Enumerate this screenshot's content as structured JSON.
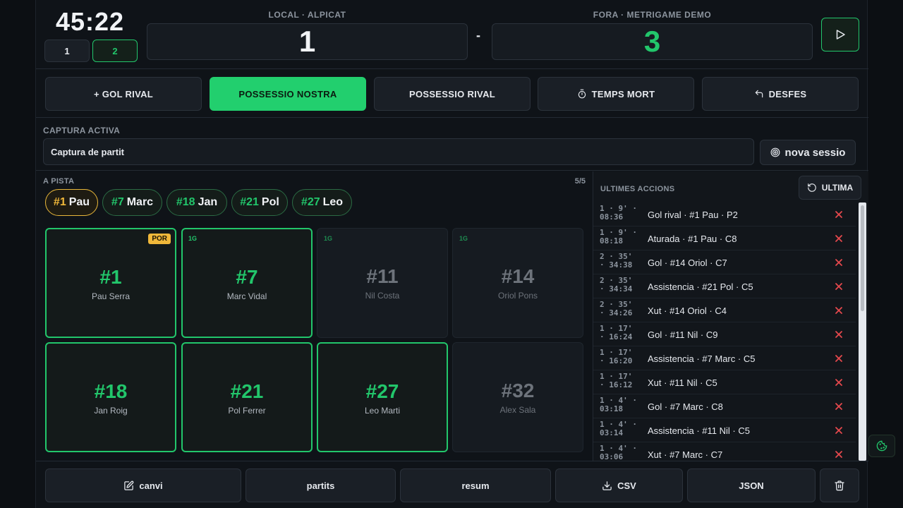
{
  "header": {
    "clock": "45:22",
    "halves": [
      "1",
      "2"
    ],
    "active_half": "2",
    "home_label": "LOCAL · ALPICAT",
    "away_label": "FORA · METRIGAME DEMO",
    "home_score": "1",
    "away_score": "3",
    "separator": "-"
  },
  "actions": {
    "gol_rival": "+ GOL RIVAL",
    "possessio_nostra": "POSSESSIO NOSTRA",
    "possessio_rival": "POSSESSIO RIVAL",
    "temps_mort": "TEMPS MORT",
    "desfes": "DESFES"
  },
  "capture": {
    "label": "CAPTURA ACTIVA",
    "value": "Captura de partit",
    "new_session": "nova sessio"
  },
  "pitch": {
    "label": "A PISTA",
    "count": "5/5",
    "chips": [
      {
        "num": "#1",
        "name": "Pau",
        "gk": true
      },
      {
        "num": "#7",
        "name": "Marc",
        "gk": false
      },
      {
        "num": "#18",
        "name": "Jan",
        "gk": false
      },
      {
        "num": "#21",
        "name": "Pol",
        "gk": false
      },
      {
        "num": "#27",
        "name": "Leo",
        "gk": false
      }
    ],
    "players": [
      {
        "num": "#1",
        "name": "Pau Serra",
        "on": true,
        "goals": "",
        "role": "POR"
      },
      {
        "num": "#7",
        "name": "Marc Vidal",
        "on": true,
        "goals": "1G",
        "role": ""
      },
      {
        "num": "#11",
        "name": "Nil Costa",
        "on": false,
        "goals": "1G",
        "role": ""
      },
      {
        "num": "#14",
        "name": "Oriol Pons",
        "on": false,
        "goals": "1G",
        "role": ""
      },
      {
        "num": "#18",
        "name": "Jan Roig",
        "on": true,
        "goals": "",
        "role": ""
      },
      {
        "num": "#21",
        "name": "Pol Ferrer",
        "on": true,
        "goals": "",
        "role": ""
      },
      {
        "num": "#27",
        "name": "Leo Marti",
        "on": true,
        "goals": "",
        "role": ""
      },
      {
        "num": "#32",
        "name": "Alex Sala",
        "on": false,
        "goals": "",
        "role": ""
      }
    ]
  },
  "log": {
    "title": "ULTIMES ACCIONS",
    "last_button": "ULTIMA",
    "entries": [
      {
        "time": "1 · 9' ·\n08:36",
        "desc": "Gol rival · #1 Pau · P2"
      },
      {
        "time": "1 · 9' ·\n08:18",
        "desc": "Aturada · #1 Pau · C8"
      },
      {
        "time": "2 · 35'\n· 34:38",
        "desc": "Gol · #14 Oriol · C7"
      },
      {
        "time": "2 · 35'\n· 34:34",
        "desc": "Assistencia · #21 Pol · C5"
      },
      {
        "time": "2 · 35'\n· 34:26",
        "desc": "Xut · #14 Oriol · C4"
      },
      {
        "time": "1 · 17'\n· 16:24",
        "desc": "Gol · #11 Nil · C9"
      },
      {
        "time": "1 · 17'\n· 16:20",
        "desc": "Assistencia · #7 Marc · C5"
      },
      {
        "time": "1 · 17'\n· 16:12",
        "desc": "Xut · #11 Nil · C5"
      },
      {
        "time": "1 · 4' ·\n03:18",
        "desc": "Gol · #7 Marc · C8"
      },
      {
        "time": "1 · 4' ·\n03:14",
        "desc": "Assistencia · #11 Nil · C5"
      },
      {
        "time": "1 · 4' ·\n03:06",
        "desc": "Xut · #7 Marc · C7"
      }
    ]
  },
  "footer": {
    "canvi": "canvi",
    "partits": "partits",
    "resum": "resum",
    "csv": "CSV",
    "json": "JSON"
  },
  "icons": {
    "play": "play-icon",
    "timer": "stopwatch-icon",
    "undo": "undo-icon",
    "new_session": "target-icon",
    "refresh": "refresh-icon",
    "delete_entry": "close-icon",
    "edit": "edit-icon",
    "download": "download-icon",
    "trash": "trash-icon",
    "cookie": "cookie-icon"
  },
  "colors": {
    "accent_green": "#22c66b",
    "goalkeeper_gold": "#f0b83a",
    "delete_red": "#e5484d",
    "background": "#0f1318"
  }
}
